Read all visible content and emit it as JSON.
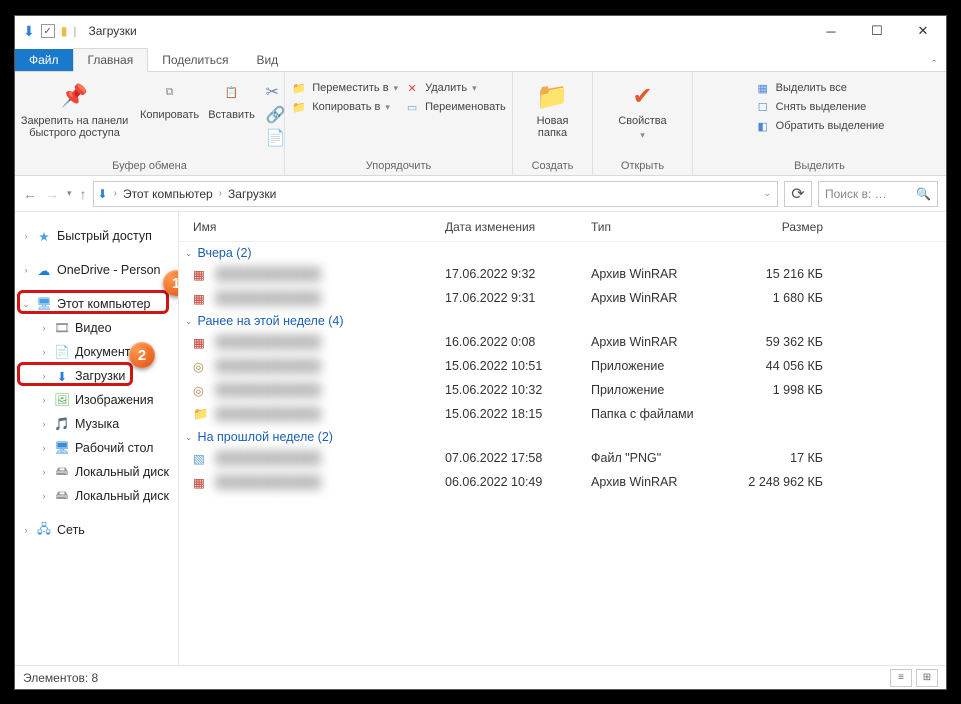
{
  "titlebar": {
    "title": "Загрузки"
  },
  "tabs": {
    "file": "Файл",
    "home": "Главная",
    "share": "Поделиться",
    "view": "Вид"
  },
  "ribbon": {
    "clipboard": {
      "pin": "Закрепить на панели быстрого доступа",
      "copy": "Копировать",
      "paste": "Вставить",
      "label": "Буфер обмена"
    },
    "organize": {
      "moveTo": "Переместить в",
      "copyTo": "Копировать в",
      "delete": "Удалить",
      "rename": "Переименовать",
      "label": "Упорядочить"
    },
    "new": {
      "folder": "Новая папка",
      "label": "Создать"
    },
    "open": {
      "props": "Свойства",
      "label": "Открыть"
    },
    "select": {
      "all": "Выделить все",
      "none": "Снять выделение",
      "invert": "Обратить выделение",
      "label": "Выделить"
    }
  },
  "addr": {
    "root": "Этот компьютер",
    "current": "Загрузки",
    "searchPlaceholder": "Поиск в: …"
  },
  "sidebar": {
    "quick": "Быстрый доступ",
    "onedrive": "OneDrive - Person",
    "thispc": "Этот компьютер",
    "video": "Видео",
    "documents": "Документы",
    "downloads": "Загрузки",
    "images": "Изображения",
    "music": "Музыка",
    "desktop": "Рабочий стол",
    "disk1": "Локальный диск",
    "disk2": "Локальный диск",
    "network": "Сеть"
  },
  "columns": {
    "name": "Имя",
    "date": "Дата изменения",
    "type": "Тип",
    "size": "Размер"
  },
  "groups": [
    {
      "title": "Вчера (2)",
      "items": [
        {
          "date": "17.06.2022 9:32",
          "type": "Архив WinRAR",
          "size": "15 216 КБ",
          "icon": "rar"
        },
        {
          "date": "17.06.2022 9:31",
          "type": "Архив WinRAR",
          "size": "1 680 КБ",
          "icon": "rar"
        }
      ]
    },
    {
      "title": "Ранее на этой неделе (4)",
      "items": [
        {
          "date": "16.06.2022 0:08",
          "type": "Архив WinRAR",
          "size": "59 362 КБ",
          "icon": "rar"
        },
        {
          "date": "15.06.2022 10:51",
          "type": "Приложение",
          "size": "44 056 КБ",
          "icon": "exe"
        },
        {
          "date": "15.06.2022 10:32",
          "type": "Приложение",
          "size": "1 998 КБ",
          "icon": "exe"
        },
        {
          "date": "15.06.2022 18:15",
          "type": "Папка с файлами",
          "size": "",
          "icon": "folder"
        }
      ]
    },
    {
      "title": "На прошлой неделе (2)",
      "items": [
        {
          "date": "07.06.2022 17:58",
          "type": "Файл \"PNG\"",
          "size": "17 КБ",
          "icon": "png"
        },
        {
          "date": "06.06.2022 10:49",
          "type": "Архив WinRAR",
          "size": "2 248 962 КБ",
          "icon": "rar"
        }
      ]
    }
  ],
  "status": {
    "items": "Элементов: 8"
  }
}
